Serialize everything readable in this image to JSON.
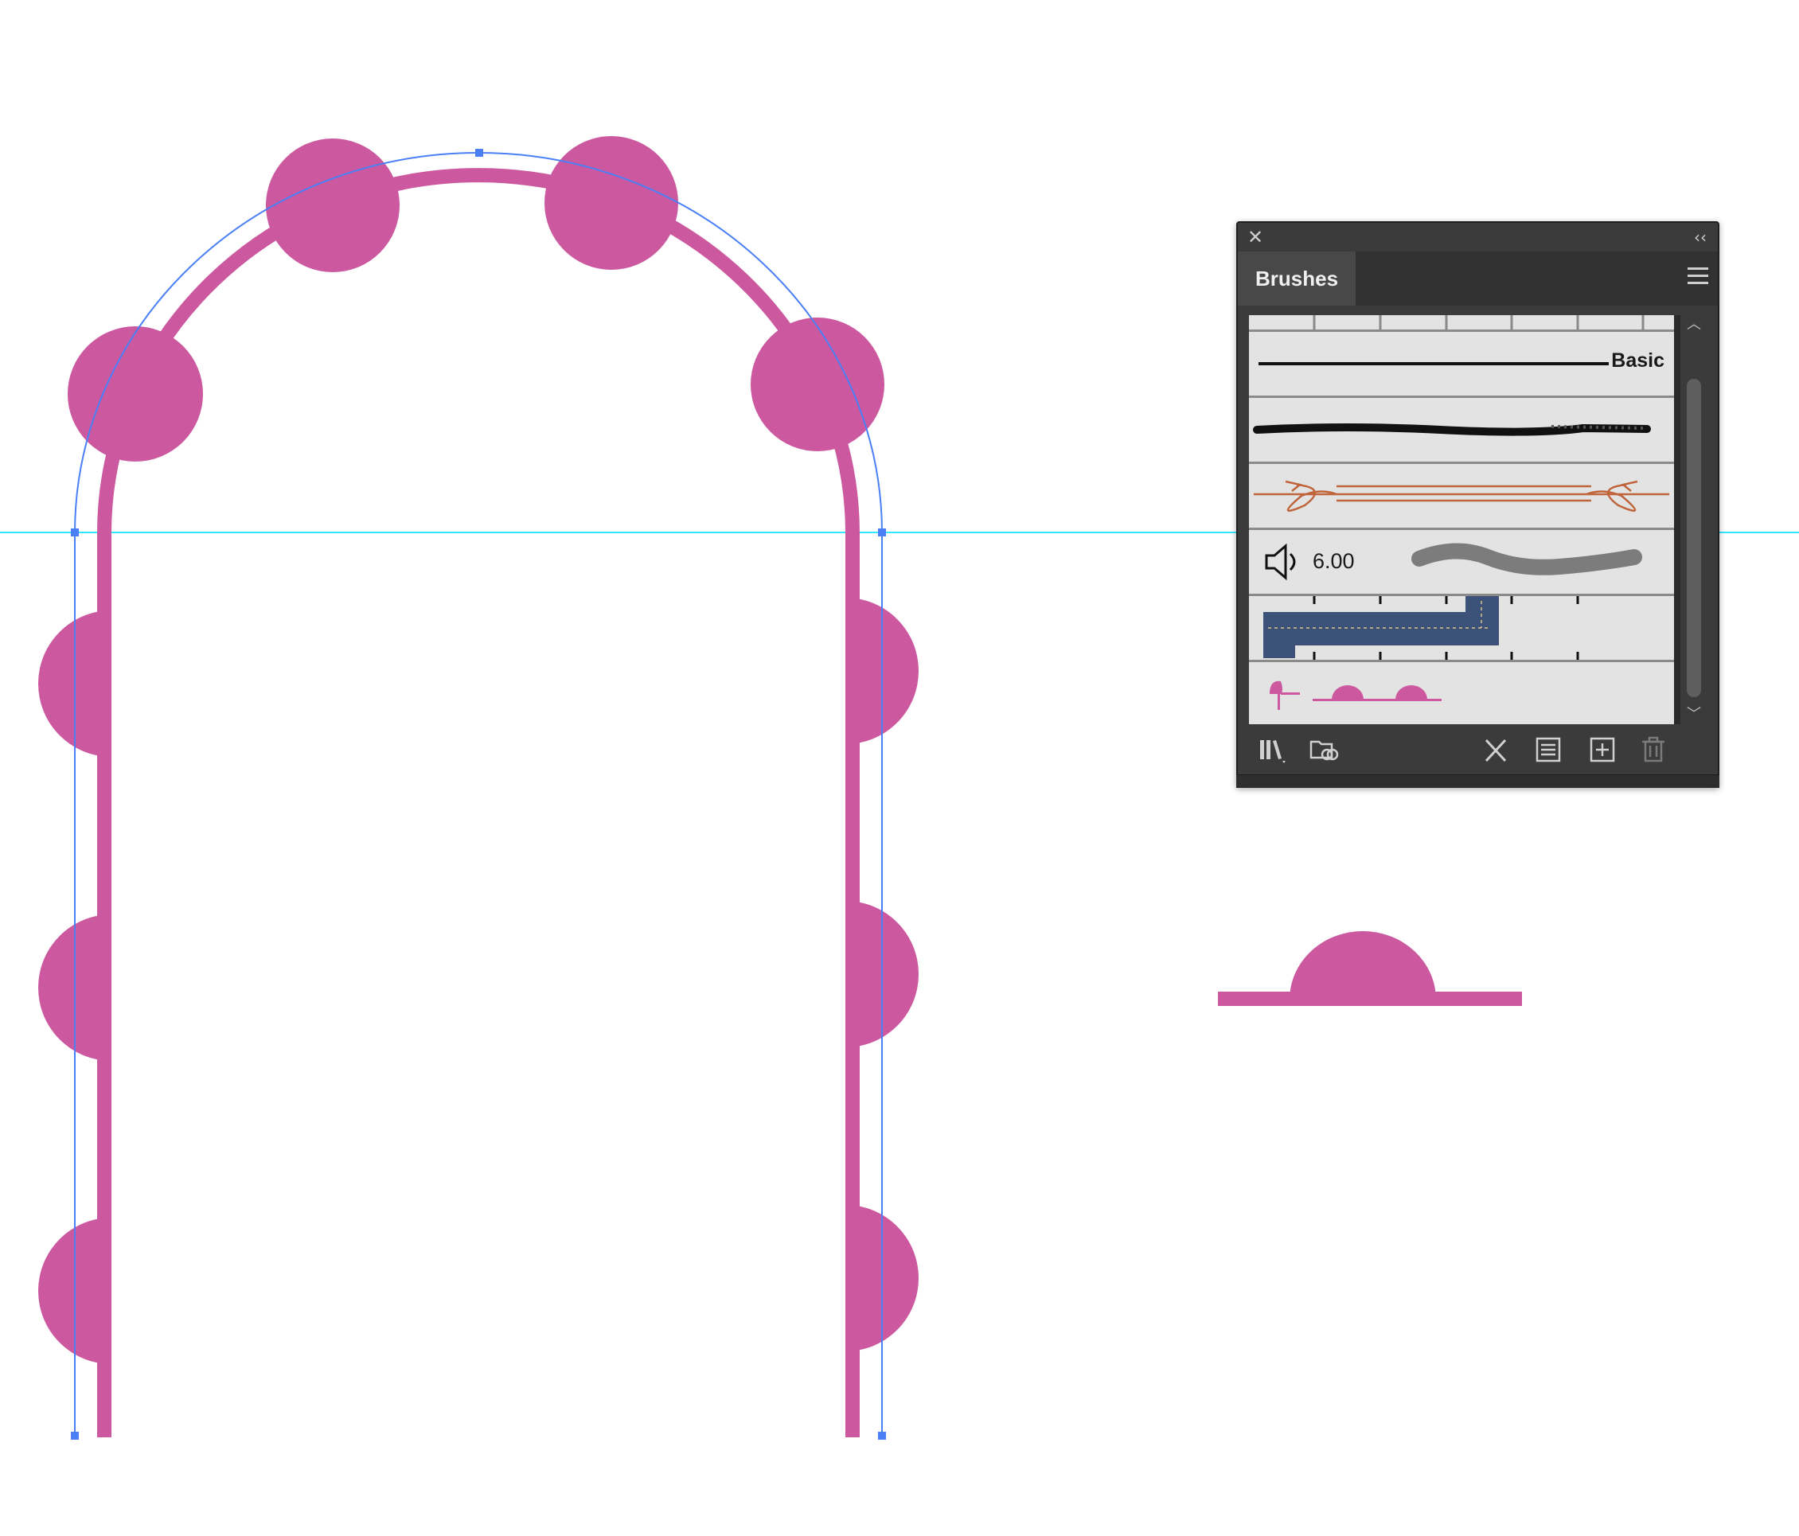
{
  "panel": {
    "title": "Brushes",
    "close_icon": "close-icon",
    "collapse_icon": "collapse-double-chevron-icon",
    "menu_icon": "panel-menu-icon"
  },
  "brushes": [
    {
      "id": "basic",
      "label": "Basic",
      "icon": "basic-line-brush"
    },
    {
      "id": "charcoal",
      "icon": "charcoal-art-brush"
    },
    {
      "id": "ornament",
      "icon": "ornamental-arrow-brush"
    },
    {
      "id": "bristle",
      "value": "6.00",
      "icon": "speaker-bristle-brush"
    },
    {
      "id": "denim",
      "icon": "denim-pattern-brush"
    },
    {
      "id": "scallop",
      "icon": "scallop-pattern-brush"
    }
  ],
  "toolbar": {
    "buttons": [
      "brush-libraries-icon",
      "cc-libraries-icon",
      "remove-brush-stroke-icon",
      "brush-options-icon",
      "new-brush-icon",
      "delete-brush-icon"
    ]
  },
  "colors": {
    "accent_pink": "#cc58a0",
    "selection_blue": "#4a7ff5",
    "guide_cyan": "#33e6ff",
    "panel_bg": "#3b3b3b"
  }
}
